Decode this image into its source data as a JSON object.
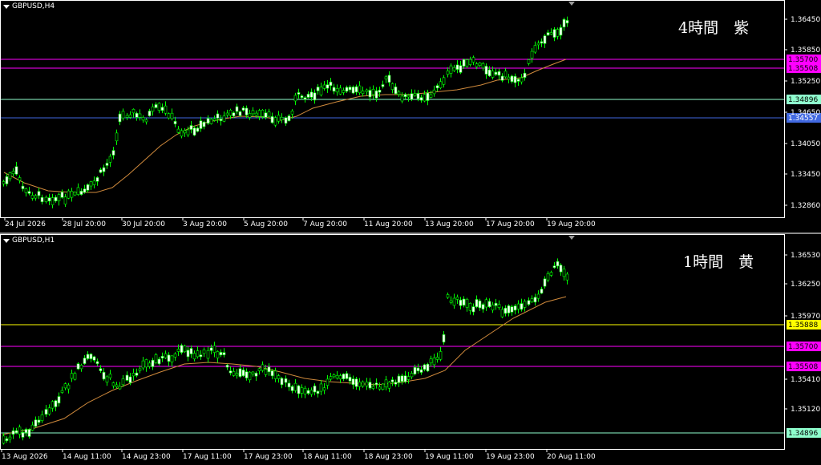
{
  "colors": {
    "bg": "#000000",
    "frame": "#ffffff",
    "bull": "#00ff00",
    "bear": "#ffffff",
    "ma": "#d08a3c",
    "magenta": "#ff00ff",
    "yellow": "#ffff00",
    "mint": "#8fffce",
    "blue": "#4169e1"
  },
  "h4": {
    "symbol": "GBPUSD,H4",
    "title": "4時間　紫",
    "title_color": "#ff00ff",
    "icons": [
      "triangle-down-icon",
      "shift-marker-icon"
    ],
    "y_ticks": [
      "1.36450",
      "1.35850",
      "1.35250",
      "1.34650",
      "1.34050",
      "1.33450",
      "1.32860"
    ],
    "x_ticks": [
      "24 Jul 2026",
      "28 Jul 20:00",
      "30 Jul 20:00",
      "3 Aug 20:00",
      "5 Aug 20:00",
      "7 Aug 20:00",
      "11 Aug 20:00",
      "13 Aug 20:00",
      "17 Aug 20:00",
      "19 Aug 20:00"
    ],
    "levels": [
      {
        "label": "1.35700",
        "color": "#ff00ff",
        "text_color": "#000000"
      },
      {
        "label": "1.35508",
        "color": "#ff00ff",
        "text_color": "#000000"
      },
      {
        "label": "1.34896",
        "color": "#8fffce",
        "text_color": "#000000"
      },
      {
        "label": "1.34557",
        "color": "#4169e1",
        "text_color": "#ffffff"
      }
    ]
  },
  "h1": {
    "symbol": "GBPUSD,H1",
    "title": "1時間　黄",
    "title_color": "#ffff00",
    "icons": [
      "triangle-down-icon",
      "shift-marker-icon"
    ],
    "y_ticks": [
      "1.36530",
      "1.36250",
      "1.35970",
      "1.35410",
      "1.35120"
    ],
    "x_ticks": [
      "13 Aug 2026",
      "14 Aug 11:00",
      "14 Aug 23:00",
      "17 Aug 11:00",
      "17 Aug 23:00",
      "18 Aug 11:00",
      "18 Aug 23:00",
      "19 Aug 11:00",
      "19 Aug 23:00",
      "20 Aug 11:00"
    ],
    "levels": [
      {
        "label": "1.35888",
        "color": "#ffff00",
        "text_color": "#000000"
      },
      {
        "label": "1.35700",
        "color": "#ff00ff",
        "text_color": "#000000"
      },
      {
        "label": "1.35508",
        "color": "#ff00ff",
        "text_color": "#000000"
      },
      {
        "label": "1.34896",
        "color": "#8fffce",
        "text_color": "#000000"
      }
    ]
  }
}
